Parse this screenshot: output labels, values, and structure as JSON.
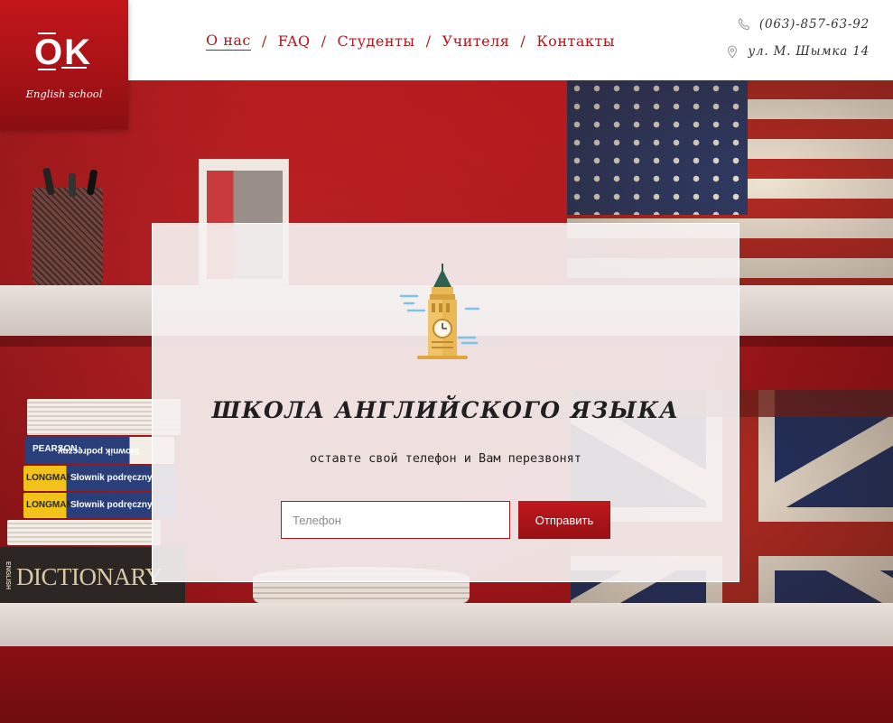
{
  "brand": {
    "logo_text": "OK",
    "tagline": "English school"
  },
  "nav": {
    "items": [
      {
        "label": "О нас",
        "active": true
      },
      {
        "label": "FAQ",
        "active": false
      },
      {
        "label": "Студенты",
        "active": false
      },
      {
        "label": "Учителя",
        "active": false
      },
      {
        "label": "Контакты",
        "active": false
      }
    ],
    "separator": "/"
  },
  "contact": {
    "phone": "(063)-857-63-92",
    "address": "ул. М. Шымка 14",
    "phone_icon": "phone-icon",
    "address_icon": "map-pin-icon"
  },
  "hero": {
    "illustration": "big-ben-icon",
    "title": "ШКОЛА АНГЛИЙСКОГО ЯЗЫКА",
    "subtitle": "оставте свой телефон и  Вам перезвонят"
  },
  "form": {
    "phone_placeholder": "Телефон",
    "phone_value": "",
    "submit_label": "Отправить"
  },
  "background": {
    "books": [
      {
        "brand": "PEARSON",
        "title": "Słownik podręczny"
      },
      {
        "brand": "LONGMAN",
        "title": "Słownik podręczny"
      },
      {
        "brand": "LONGMAN",
        "title": "Słownik podręczny"
      }
    ],
    "dictionary_spine": "DICTIONARY",
    "dictionary_side": "ENGLISH"
  },
  "colors": {
    "accent": "#b3161b",
    "header_bg": "#ffffff",
    "card_bg": "#f5f1f1"
  }
}
